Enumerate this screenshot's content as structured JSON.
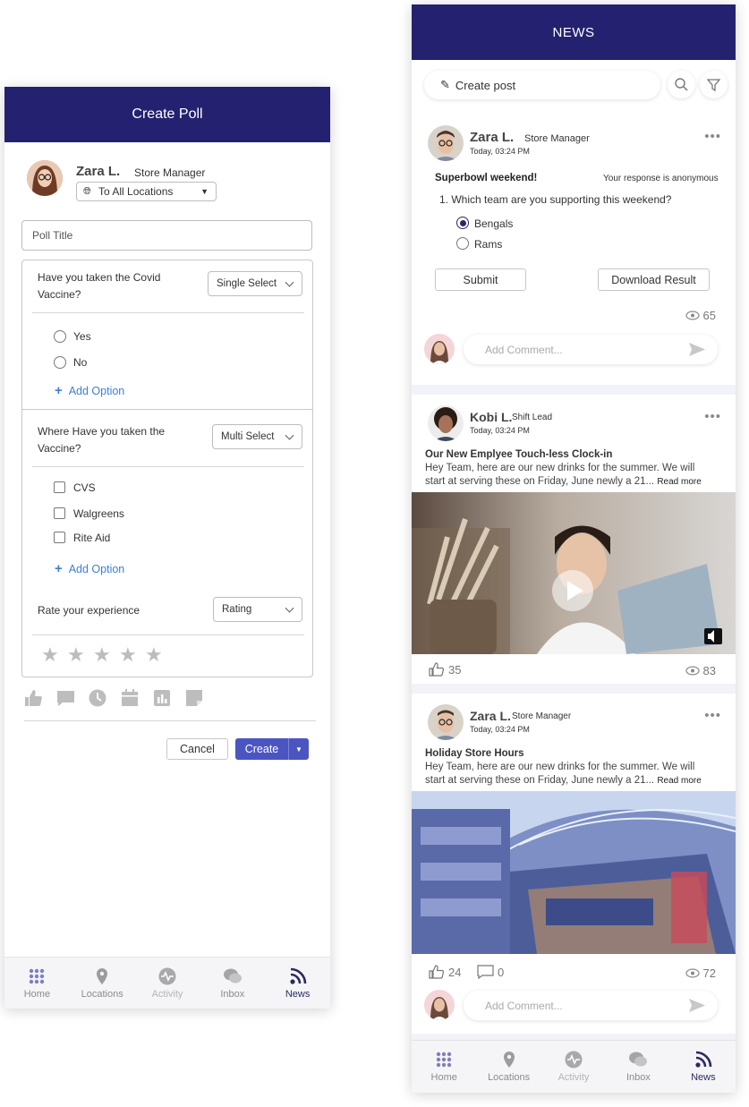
{
  "poll": {
    "title": "Create Poll",
    "user_name": "Zara L.",
    "user_role": "Store Manager",
    "audience": "To All Locations",
    "title_placeholder": "Poll Title",
    "q1": {
      "text_line1": "Have you taken the Covid",
      "text_line2": "Vaccine?",
      "type": "Single Select",
      "options": [
        "Yes",
        "No"
      ],
      "add_option": "Add Option"
    },
    "q2": {
      "text_line1": "Where Have you taken the",
      "text_line2": "Vaccine?",
      "type": "Multi Select",
      "options": [
        "CVS",
        "Walgreens",
        "Rite Aid"
      ],
      "add_option": "Add Option"
    },
    "q3": {
      "text": "Rate your experience",
      "type": "Rating",
      "stars": 5
    },
    "cancel": "Cancel",
    "create": "Create"
  },
  "news": {
    "title": "NEWS",
    "create_post": "Create post",
    "post1": {
      "author": "Zara L.",
      "role": "Store Manager",
      "time": "Today, 03:24 PM",
      "poll_title": "Superbowl weekend!",
      "anon": "Your response is anonymous",
      "question": "1. Which team are you supporting this weekend?",
      "options": [
        "Bengals",
        "Rams"
      ],
      "selected": "Bengals",
      "submit": "Submit",
      "download": "Download Result",
      "views": "65",
      "comment_placeholder": "Add Comment..."
    },
    "post2": {
      "author": "Kobi L.",
      "role": "Shift Lead",
      "time": "Today, 03:24 PM",
      "headline": "Our New Emplyee Touch-less Clock-in",
      "body_line1": "Hey Team, here are our new drinks for the summer. We will",
      "body_line2": "start at serving these on Friday, June newly a 21...",
      "read_more": "Read more",
      "likes": "35",
      "views": "83"
    },
    "post3": {
      "author": "Zara L.",
      "role": "Store Manager",
      "time": "Today, 03:24 PM",
      "headline": "Holiday Store Hours",
      "body_line1": "Hey Team, here are our new drinks for the summer. We will",
      "body_line2": "start at serving these on Friday, June newly a 21...",
      "read_more": "Read more",
      "likes": "24",
      "comments": "0",
      "views": "72",
      "comment_placeholder": "Add Comment..."
    }
  },
  "tabs": [
    "Home",
    "Locations",
    "Activity",
    "Inbox",
    "News"
  ],
  "colors": {
    "header": "#242270",
    "accent": "#4a55c2",
    "link": "#3d7fd1"
  }
}
